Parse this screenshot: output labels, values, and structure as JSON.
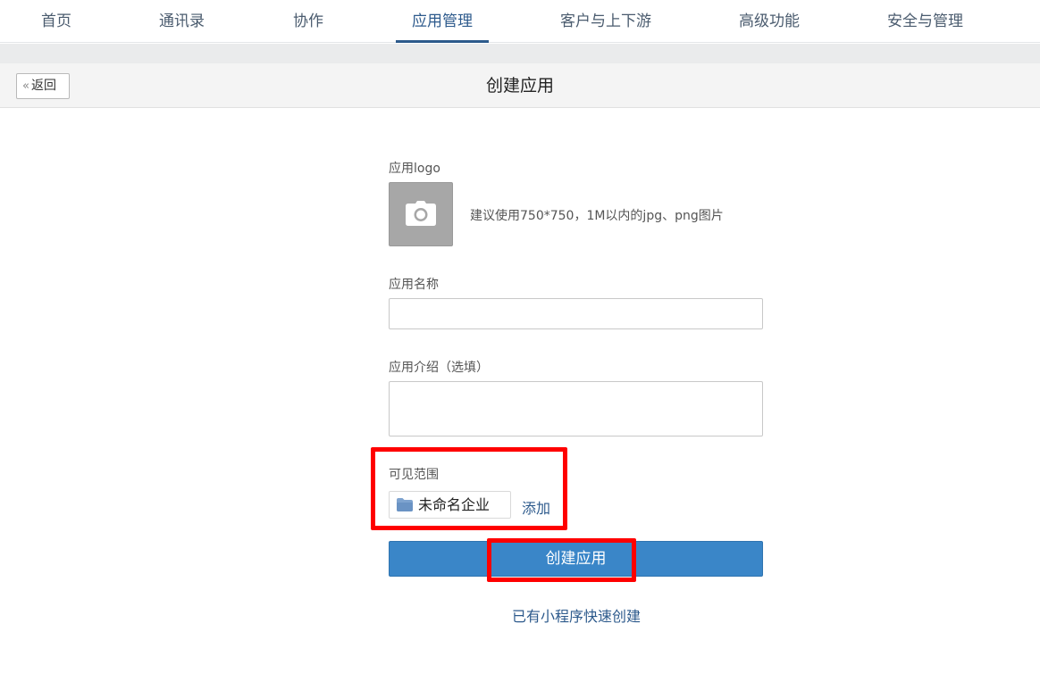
{
  "nav": {
    "items": [
      {
        "label": "首页"
      },
      {
        "label": "通讯录"
      },
      {
        "label": "协作"
      },
      {
        "label": "应用管理"
      },
      {
        "label": "客户与上下游"
      },
      {
        "label": "高级功能"
      },
      {
        "label": "安全与管理"
      }
    ],
    "active_index": 3
  },
  "header": {
    "back_label": "返回",
    "title": "创建应用"
  },
  "form": {
    "logo_label": "应用logo",
    "logo_hint": "建议使用750*750，1M以内的jpg、png图片",
    "name_label": "应用名称",
    "name_value": "",
    "intro_label": "应用介绍（选填）",
    "intro_value": "",
    "scope_label": "可见范围",
    "scope_item": "未命名企业",
    "scope_add": "添加",
    "submit_label": "创建应用",
    "quick_create": "已有小程序快速创建"
  },
  "colors": {
    "accent": "#2d5a8c",
    "button": "#3a86c8",
    "highlight": "#ff0000"
  },
  "icons": {
    "back": "double-chevron-left-icon",
    "logo": "camera-icon",
    "scope": "folder-icon"
  }
}
